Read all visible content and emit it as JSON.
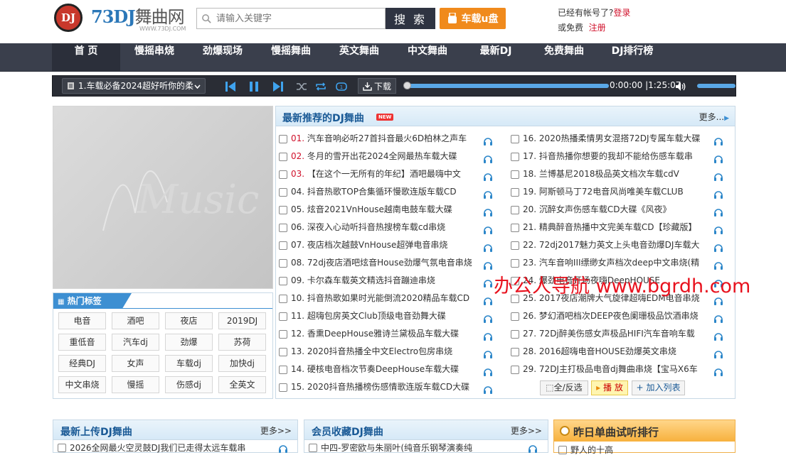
{
  "site": {
    "logo_badge": "DJ",
    "logo_name_num": "73DJ",
    "logo_name_cn": "舞曲网",
    "logo_url": "WWW.73DJ.COM",
    "search_placeholder": "请输入关键字",
    "search_button": "搜 索",
    "usb_button": "车载u盘",
    "login_prompt": "已经有帐号了?",
    "login_link": "登录",
    "register_prompt": "或免费",
    "register_link": "注册"
  },
  "nav": [
    "首 页",
    "慢摇串烧",
    "劲爆现场",
    "慢摇舞曲",
    "英文舞曲",
    "中文舞曲",
    "最新DJ",
    "免费舞曲",
    "DJ排行榜"
  ],
  "player": {
    "current_track": "1.车载必备2024超好听你的柔",
    "download_label": "下载",
    "time_current": "0:00:00",
    "time_total": "1:25:07",
    "progress": 0.0,
    "volume": 0.85
  },
  "left_art_text": "Music",
  "tags": {
    "title": "热门标签",
    "items": [
      "电音",
      "酒吧",
      "夜店",
      "2019DJ",
      "重低音",
      "汽车dj",
      "劲爆",
      "苏荷",
      "经典DJ",
      "女声",
      "车载dj",
      "加快dj",
      "中文串烧",
      "慢摇",
      "伤感dj",
      "全英文"
    ]
  },
  "recommend": {
    "title": "最新推荐的DJ舞曲",
    "new_badge": "NEW",
    "more": "更多...",
    "left": [
      {
        "num": "01.",
        "title": "汽车音响必听27首抖音最火6D柏林之声车",
        "hot": true
      },
      {
        "num": "02.",
        "title": "冬月的雪开出花2024全网最热车载大碟",
        "hot": true
      },
      {
        "num": "03.",
        "title": "【在这个一无所有的年纪】酒吧最嗨中文",
        "hot": true
      },
      {
        "num": "04.",
        "title": "抖音热歌TOP合集循环慢歌连版车载CD",
        "hot": false
      },
      {
        "num": "05.",
        "title": "炫音2021VnHouse越南电鼓车载大碟",
        "hot": false
      },
      {
        "num": "06.",
        "title": "深夜入心动听抖音热搜榜车载cd串烧",
        "hot": false
      },
      {
        "num": "07.",
        "title": "夜店档次越鼓VnHouse超弹电音串烧",
        "hot": false
      },
      {
        "num": "08.",
        "title": "72dj夜店酒吧炫音House劲爆气氛电音串烧",
        "hot": false
      },
      {
        "num": "09.",
        "title": "卡尔森车载英文精选抖音蹦迪串烧",
        "hot": false
      },
      {
        "num": "10.",
        "title": "抖音热歌如果时光能倒流2020精品车载CD",
        "hot": false
      },
      {
        "num": "11.",
        "title": "超嗨包房英文Club顶级电音劲舞大碟",
        "hot": false
      },
      {
        "num": "12.",
        "title": "香熏DeepHouse雅诗兰黛极品车载大碟",
        "hot": false
      },
      {
        "num": "13.",
        "title": "2020抖音热播全中文Electro包房串烧",
        "hot": false
      },
      {
        "num": "14.",
        "title": "硬核电音档次节奏DeepHouse车载大碟",
        "hot": false
      },
      {
        "num": "15.",
        "title": "2020抖音热播榜伤感情歌连版车载CD大碟",
        "hot": false
      }
    ],
    "right": [
      {
        "num": "16.",
        "title": "2020热播柔情男女混搭72DJ专属车载大碟"
      },
      {
        "num": "17.",
        "title": "抖音热播你想要的我却不能给伤感车载串"
      },
      {
        "num": "18.",
        "title": "兰博基尼2018极品英文档次车载cdV"
      },
      {
        "num": "19.",
        "title": "阿斯顿马丁72电音风尚唯美车载CLUB"
      },
      {
        "num": "20.",
        "title": "沉醉女声伤感车载CD大碟《风夜》"
      },
      {
        "num": "21.",
        "title": "精典醉音热播中文完美车载CD【珍藏版】"
      },
      {
        "num": "22.",
        "title": "72dj2017魅力英文上头电音劲爆DJ车载大"
      },
      {
        "num": "23.",
        "title": "汽车音响III缥缈女声档次deep中文串烧(精"
      },
      {
        "num": "24.",
        "title": "爆劲电音开场夜嗨DeepHOUSE"
      },
      {
        "num": "25.",
        "title": "2017夜店潮牌大气旋律超嗨EDM电音串烧"
      },
      {
        "num": "26.",
        "title": "梦幻酒吧档次DEEP夜色阑珊极品饮酒串烧"
      },
      {
        "num": "27.",
        "title": "72Dj醉美伤感女声极品HIFI汽车音响车载"
      },
      {
        "num": "28.",
        "title": "2016超嗨电音HOUSE劲爆英文串烧"
      },
      {
        "num": "29.",
        "title": "72DJ主打极品电音dj舞曲串烧【宝马X6车"
      }
    ],
    "btn_select": "全/反选",
    "btn_play": "播 放",
    "btn_add": "加入列表"
  },
  "watermark": "办公人导航 www.bgrdh.com",
  "latest_upload": {
    "title": "最新上传DJ舞曲",
    "more": "更多>>",
    "first_item": "2026全网最火空灵鼓DJ我们已走得太远车载串"
  },
  "member_fav": {
    "title": "会员收藏DJ舞曲",
    "more": "更多>>",
    "first_item": "中四-罗密欧与朱丽叶(纯音乐钢琴演奏纯"
  },
  "yesterday_rank": {
    "title": "昨日单曲试听排行",
    "first_item": "野人的十高"
  },
  "colors": {
    "nav_bg": "#3a3f4c",
    "accent_orange": "#f08a1c",
    "title_blue": "#1a5a96",
    "hot_red": "#d0112b",
    "headphone_blue": "#2b86c9"
  }
}
